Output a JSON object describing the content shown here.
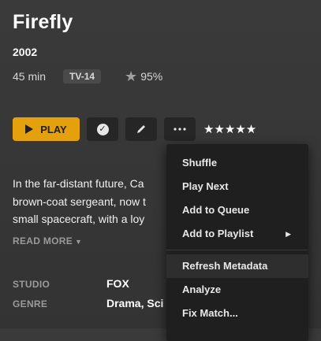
{
  "title": "Firefly",
  "year": "2002",
  "duration": "45 min",
  "content_rating": "TV-14",
  "audience_score": "95%",
  "toolbar": {
    "play_label": "PLAY",
    "user_stars": "★★★★★"
  },
  "summary_lines": [
    "In the far-distant future, Ca",
    "brown-coat sergeant, now t",
    "small spacecraft, with a loy"
  ],
  "read_more": "READ MORE",
  "details": [
    {
      "label": "STUDIO",
      "value": "FOX"
    },
    {
      "label": "GENRE",
      "value": "Drama, Sci"
    }
  ],
  "menu": {
    "items": [
      {
        "label": "Shuffle",
        "submenu": false
      },
      {
        "label": "Play Next",
        "submenu": false
      },
      {
        "label": "Add to Queue",
        "submenu": false
      },
      {
        "label": "Add to Playlist",
        "submenu": true
      },
      {
        "label": "Refresh Metadata",
        "submenu": false
      },
      {
        "label": "Analyze",
        "submenu": false
      },
      {
        "label": "Fix Match...",
        "submenu": false
      }
    ],
    "highlighted": "Refresh Metadata"
  },
  "colors": {
    "accent": "#e5a00d",
    "background": "#373737",
    "menu_background": "#1f1f1f"
  },
  "icons": [
    "play-icon",
    "check-icon",
    "pencil-icon",
    "more-icon",
    "star-icon",
    "chevron-down-icon",
    "chevron-right-icon"
  ]
}
